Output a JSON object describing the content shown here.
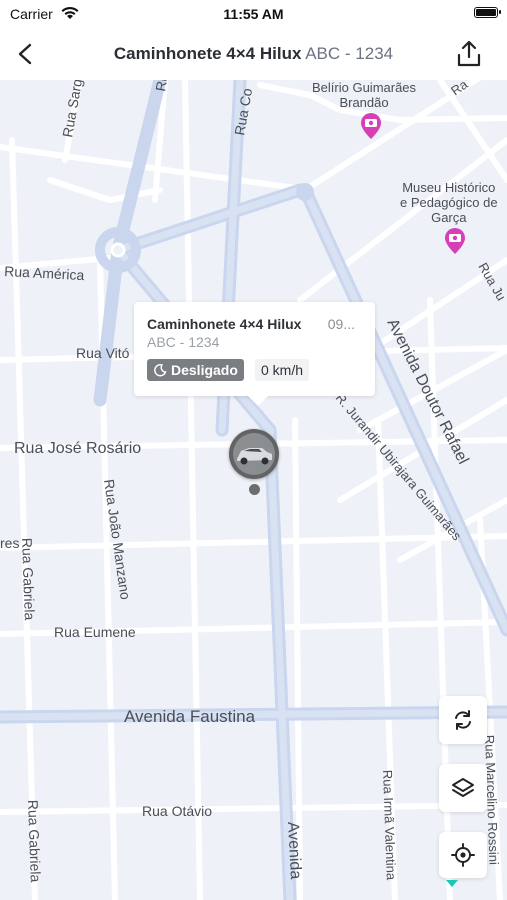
{
  "status_bar": {
    "carrier": "Carrier",
    "time": "11:55 AM"
  },
  "nav": {
    "title": "Caminhonete 4×4 Hilux",
    "subtitle": "ABC - 1234"
  },
  "popup": {
    "title": "Caminhonete 4×4 Hilux",
    "time": "09...",
    "plate": "ABC - 1234",
    "status": "Desligado",
    "speed": "0 km/h"
  },
  "map": {
    "streets": {
      "rua_sarg": "Rua Sarg",
      "rua_co": "Rua Co",
      "rua_r": "Ru",
      "rua_america": "Rua América",
      "rua_vito": "Rua Vitó",
      "rua_jose_rosario": "Rua José Rosário",
      "rua_joao_manzano": "Rua João Manzano",
      "rua_gabriela_1": "Rua Gabriela",
      "rua_gabriela_2": "Rua Gabriela",
      "rua_eumene": "Rua Eumene",
      "avenida_faustina": "Avenida Faustina",
      "rua_otavio": "Rua Otávio",
      "avenida_bottom": "Avenida",
      "rua_irma_valentina": "Rua Irmã Valentina",
      "rua_marcelino_rossini": "Rua Marcelino Rossini",
      "avenida_doutor_rafael": "Avenida Doutor Rafael",
      "rua_jurandir": "R. Jurandir Ubirajara Guimarães",
      "rua_ju": "Rua Ju",
      "rua_ra": "Ra",
      "res": "res"
    },
    "pois": [
      {
        "name": "Belírio Guimarães Brandão",
        "line1": "Belírio Guimarães",
        "line2": "Brandão"
      },
      {
        "name": "Museu Histórico e Pedagógico de Garça",
        "line1": "Museu Histórico",
        "line2": "e Pedagógico de",
        "line3": "Garça"
      }
    ]
  },
  "colors": {
    "map_bg": "#eef1f7",
    "road": "#ffffff",
    "main_road": "#c8d6ee",
    "poi": "#d63fb5",
    "status_badge": "#7a7e83",
    "accent": "#1ec6b3"
  },
  "icons": [
    "wifi-icon",
    "battery-icon",
    "back-arrow-icon",
    "share-icon",
    "moon-icon",
    "refresh-icon",
    "layers-icon",
    "locate-icon",
    "camera-icon"
  ]
}
